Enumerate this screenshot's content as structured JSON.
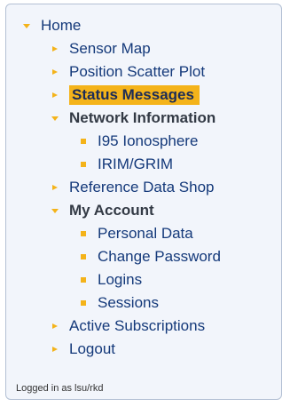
{
  "nav": {
    "home": "Home",
    "sensor_map": "Sensor Map",
    "position_scatter_plot": "Position Scatter Plot",
    "status_messages": "Status Messages",
    "network_information": "Network Information",
    "i95_ionosphere": "I95 Ionosphere",
    "irim_grim": "IRIM/GRIM",
    "reference_data_shop": "Reference Data Shop",
    "my_account": "My Account",
    "personal_data": "Personal Data",
    "change_password": "Change Password",
    "logins": "Logins",
    "sessions": "Sessions",
    "active_subscriptions": "Active Subscriptions",
    "logout": "Logout"
  },
  "footer": {
    "logged_in_text": "Logged in as lsu/rkd"
  },
  "colors": {
    "accent": "#f4b31a",
    "link": "#14397a",
    "panel_bg": "#f2f5fb",
    "panel_border": "#b3c0d4"
  },
  "icons": {
    "expanded": "caret-down-icon",
    "collapsed": "caret-right-icon",
    "bullet": "bullet-icon"
  }
}
